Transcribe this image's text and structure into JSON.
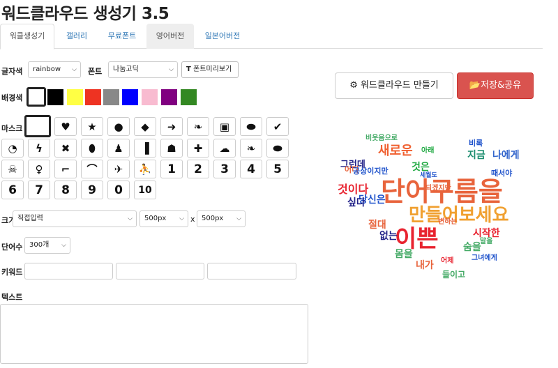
{
  "app": {
    "title": "워드클라우드 생성기 3.5"
  },
  "tabs": [
    "워클생성기",
    "갤러리",
    "무료폰트",
    "영어버전",
    "일본어버전"
  ],
  "controls": {
    "text_color_label": "글자색",
    "text_color_value": "rainbow",
    "font_label": "폰트",
    "font_value": "나눔고딕",
    "font_preview_button": "폰트미리보기",
    "bg_color_label": "배경색",
    "mask_label": "마스크",
    "size_label": "크기",
    "size_mode_value": "직접입력",
    "width_value": "500px",
    "times": "x",
    "height_value": "500px",
    "word_count_label": "단어수",
    "word_count_value": "300개",
    "keyword_label": "키워드",
    "text_label": "텍스트"
  },
  "bg_colors": [
    "#ffffff",
    "#000000",
    "#ffff44",
    "#ee3322",
    "#888888",
    "#0000ff",
    "#f8bbd0",
    "#800080",
    "#338822"
  ],
  "numbers": [
    "1",
    "2",
    "3",
    "4",
    "5",
    "6",
    "7",
    "8",
    "9",
    "0",
    "10"
  ],
  "buttons": {
    "make": "워드클라우드 만들기",
    "save": "저장&공유"
  },
  "cloud_words": [
    "단어구름을",
    "만들어보세요",
    "이쁜",
    "새로운",
    "것은",
    "지금",
    "나에게",
    "그런데",
    "것이다",
    "당신은",
    "절대",
    "시작한",
    "없는",
    "내가",
    "몸을",
    "숨을",
    "싶다",
    "어디",
    "공상이지만",
    "되겠지만",
    "그녀에게",
    "들이고",
    "비록",
    "때서야",
    "세월도",
    "비웃음으로",
    "아래",
    "변하는",
    "어제",
    "말을"
  ]
}
